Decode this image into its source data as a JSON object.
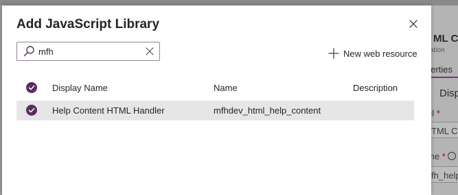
{
  "dialog": {
    "title": "Add JavaScript Library",
    "close_icon": "close-icon"
  },
  "search": {
    "value": "mfh",
    "placeholder": "",
    "icon": "search-icon",
    "clear_icon": "clear-icon"
  },
  "toolbar": {
    "new_resource_label": "New web resource",
    "new_resource_icon": "plus-icon"
  },
  "table": {
    "columns": [
      "Display Name",
      "Name",
      "Description"
    ],
    "rows": [
      {
        "selected": true,
        "display_name": "Help Content HTML Handler",
        "name": "mfhdev_html_help_content",
        "description": ""
      }
    ]
  },
  "background_page": {
    "title_fragment": "ML Co",
    "subtitle_fragment": "ation",
    "tab_fragment": "perties",
    "section_fragment": "Disp",
    "label_fragment": "el",
    "label_value_fragment": "TML Co",
    "name_fragment": "me",
    "name_value_fragment": "fh_help"
  },
  "colors": {
    "accent": "#5b2d5f",
    "row_selected": "#e6e6e6",
    "overlay": "#9a9a9a",
    "required": "#b00020"
  }
}
